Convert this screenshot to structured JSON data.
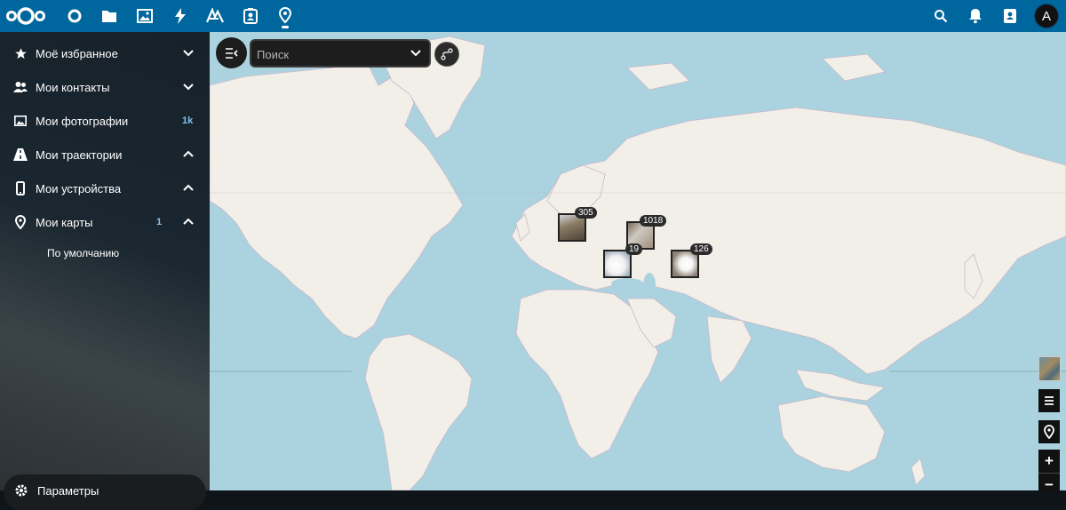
{
  "header": {
    "apps": [
      "dashboard-icon",
      "files-icon",
      "photos-icon",
      "activity-icon",
      "notes-icon",
      "contacts-icon",
      "maps-icon"
    ],
    "avatar_letter": "A"
  },
  "sidebar": {
    "items": [
      {
        "label": "Моё избранное",
        "icon": "star-icon",
        "count": ""
      },
      {
        "label": "Мои контакты",
        "icon": "contacts-group-icon",
        "count": ""
      },
      {
        "label": "Мои фотографии",
        "icon": "image-icon",
        "count": "1k"
      },
      {
        "label": "Мои траектории",
        "icon": "road-icon",
        "count": ""
      },
      {
        "label": "Мои устройства",
        "icon": "phone-icon",
        "count": ""
      },
      {
        "label": "Мои карты",
        "icon": "map-pin-icon",
        "count": "1"
      }
    ],
    "sub_item": "По умолчанию",
    "settings_label": "Параметры"
  },
  "map": {
    "search_placeholder": "Поиск",
    "clusters": [
      {
        "count": "305",
        "name": "photo-cluster-scandinavia"
      },
      {
        "count": "1018",
        "name": "photo-cluster-ural"
      },
      {
        "count": "19",
        "name": "photo-cluster-caucasus"
      },
      {
        "count": "126",
        "name": "photo-cluster-kazakhstan"
      }
    ],
    "zoom_in": "+",
    "zoom_out": "−"
  },
  "colors": {
    "header": "#00679e",
    "water": "#aad3df",
    "land": "#f2efe9",
    "accent_count": "#7fc3f2"
  }
}
